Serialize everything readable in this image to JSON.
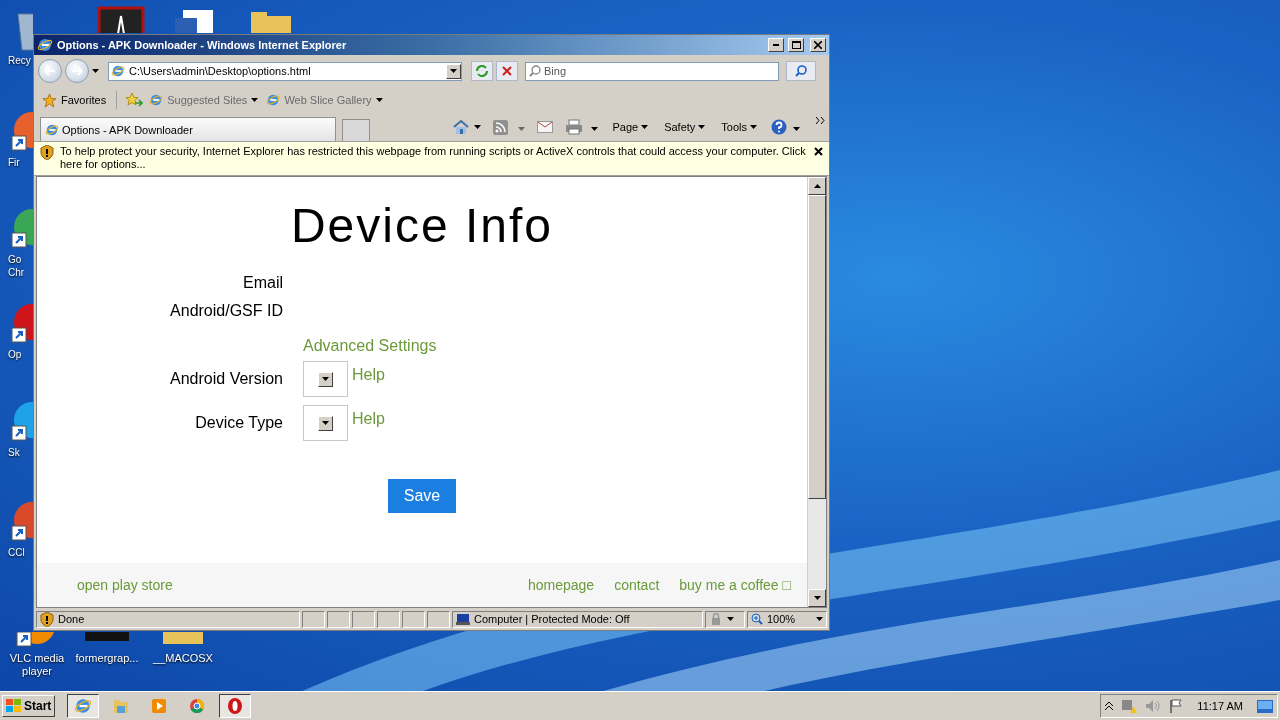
{
  "desktop": {
    "icons": [
      {
        "kind": "recycle",
        "label": "Recy"
      },
      {
        "kind": "pdf"
      },
      {
        "kind": "word"
      },
      {
        "kind": "folder"
      },
      {
        "kind": "firefox",
        "label": "Fir"
      },
      {
        "kind": "chrome",
        "label": "Go Chr"
      },
      {
        "kind": "opera",
        "label": "Op"
      },
      {
        "kind": "skype",
        "label": "Sk"
      },
      {
        "kind": "ccleaner",
        "label": "CCl"
      },
      {
        "kind": "vlc",
        "label": "VLC media player"
      },
      {
        "kind": "blank",
        "label": "formergrap..."
      },
      {
        "kind": "folder",
        "label": "__MACOSX"
      }
    ]
  },
  "window": {
    "title": "Options - APK Downloader - Windows Internet Explorer",
    "address": "C:\\Users\\admin\\Desktop\\options.html",
    "search": {
      "placeholder": "Bing"
    },
    "favorites": {
      "label": "Favorites",
      "items": [
        "Suggested Sites",
        "Web Slice Gallery"
      ]
    },
    "tabs": [
      {
        "label": "Options - APK Downloader",
        "selected": true
      }
    ],
    "command_bar": [
      "Page",
      "Safety",
      "Tools"
    ],
    "info_bar": "To help protect your security, Internet Explorer has restricted this webpage from running scripts or ActiveX controls that could access your computer. Click here for options...",
    "page": {
      "title": "Device Info",
      "fields": [
        {
          "label": "Email"
        },
        {
          "label": "Android/GSF ID"
        }
      ],
      "advanced_link": "Advanced Settings",
      "selects": [
        {
          "label": "Android Version",
          "help": "Help"
        },
        {
          "label": "Device Type",
          "help": "Help"
        }
      ],
      "save": "Save",
      "footer": {
        "left": "open play store",
        "right": [
          "homepage",
          "contact",
          "buy me a coffee □"
        ]
      }
    },
    "status_bar": {
      "text": "Done",
      "zone": "Computer | Protected Mode: Off",
      "zoom": "100%"
    }
  },
  "taskbar": {
    "start": "Start",
    "apps": [
      {
        "kind": "ie",
        "selected": true
      },
      {
        "kind": "explorer",
        "selected": false
      },
      {
        "kind": "media",
        "selected": false
      },
      {
        "kind": "chrome",
        "selected": false
      },
      {
        "kind": "opera",
        "selected": true
      }
    ],
    "clock": "11:17 AM"
  }
}
